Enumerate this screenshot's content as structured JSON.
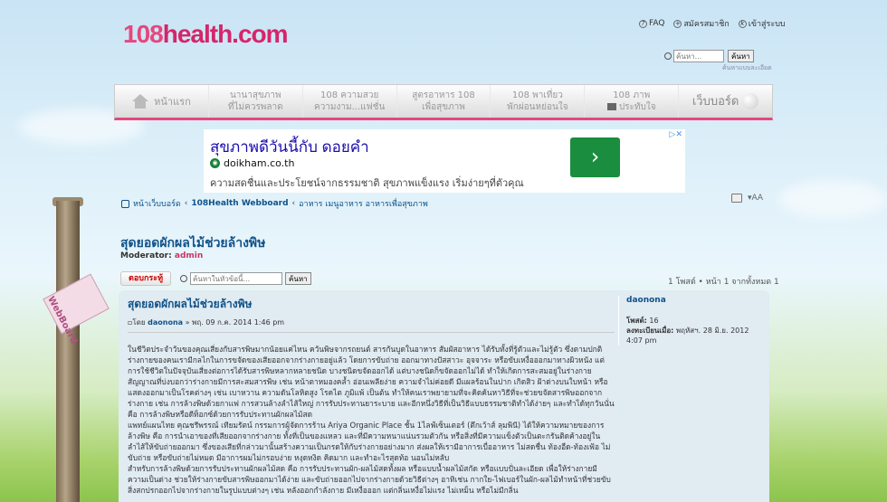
{
  "brand": {
    "logo_num": "108",
    "logo_text": "health.com"
  },
  "top_links": {
    "faq": "FAQ",
    "register": "สมัครสมาชิก",
    "login": "เข้าสู่ระบบ"
  },
  "site_search": {
    "placeholder": "ค้นหา...",
    "button": "ค้นหา",
    "advanced": "ค้นหาแบบละเอียด"
  },
  "nav": {
    "home": "หน้าแรก",
    "items": [
      {
        "line1": "นานาสุขภาพ",
        "line2": "ที่ไม่ควรพลาด"
      },
      {
        "line1": "108 ความสวย",
        "line2": "ความงาม...แฟชั่น"
      },
      {
        "line1": "สูตรอาหาร 108",
        "line2": "เพื่อสุขภาพ"
      },
      {
        "line1": "108 พาเที่ยว",
        "line2": "พักผ่อนหย่อนใจ"
      },
      {
        "line1": "108 ภาพ",
        "line2": "ประทับใจ"
      }
    ],
    "webboard": "เว็บบอร์ด"
  },
  "ad": {
    "headline": "สุขภาพดีวันนี้กับ ดอยคำ",
    "domain": "doikham.co.th",
    "description": "ความสดชื่นและประโยชน์จากธรรมชาติ สุขภาพแข็งแรง เริ่มง่ายๆที่ตัวคุณ",
    "arrow": "›"
  },
  "breadcrumb": {
    "index": "หน้าเว็บบอร์ด",
    "forum": "108Health Webboard",
    "sub": "อาหาร เมนูอาหาร อาหารเพื่อสุขภาพ"
  },
  "topic": {
    "title": "สุดยอดผักผลไม้ช่วยล้างพิษ",
    "moderator_label": "Moderator:",
    "moderator": "admin"
  },
  "actions": {
    "reply": "ตอบกระทู้",
    "search_placeholder": "ค้นหาในหัวข้อนี้...",
    "search_button": "ค้นหา"
  },
  "pagination": "1 โพสต์ • หน้า 1 จากทั้งหมด 1",
  "post": {
    "title": "สุดยอดผักผลไม้ช่วยล้างพิษ",
    "by": "โดย",
    "author": "daonona",
    "date": "» พฤ. 09 ก.ค. 2014 1:46 pm",
    "paragraphs": [
      "ในชีวิตประจำวันของคุณเสี่ยงกับสารพิษมากน้อยแค่ไหน ควันพิษจากรถยนต์ สารกันบูดในอาหาร สัมผัสอาหาร ได้รับทั้งที่รู้ตัวและไม่รู้ตัว ซึ่งตามปกติร่างกายของคนเรามีกลไกในการขจัดของเสียออกจากร่างกายอยู่แล้ว โดยการขับถ่าย ออกมาทางปัสสาวะ อุจจาระ หรือขับเหงื่อออกมาทางผิวหนัง แต่การใช้ชีวิตในปัจจุบันเสี่ยงต่อการได้รับสารพิษหลากหลายชนิด บางชนิดขจัดออกได้ แต่บางชนิดก็ขจัดออกไม่ได้ ทำให้เกิดการสะสมอยู่ในร่างกาย สัญญาณที่บ่งบอกว่าร่างกายมีการสะสมสารพิษ เช่น หน้าตาหมองคล้ำ อ่อนเพลียง่าย ความจำไม่ค่อยดี มีแผลร้อนในปาก เกิดสิว ฝ้าด่างบนใบหน้า หรือแสดงออกมาเป็นโรคต่างๆ เช่น เบาหวาน ความดันโลหิตสูง โรคไต ภูมิแพ้ เป็นต้น ทำให้คนเราพยายามที่จะคิดค้นหาวิธีที่จะช่วยขจัดสารพิษออกจากร่างกาย เช่น การล้างพิษด้วยกาแฟ การสวนล้างลำไส้ใหญ่ การรับประทานยาระบาย และอีกหนึ่งวิธีที่เป็นวิธีแบบธรรมชาติทำได้ง่ายๆ และทำได้ทุกวันนั่นคือ การล้างพิษหรือดีท็อกซ์ด้วยการรับประทานผักผลไม้สด",
      "แพทย์แผนไทย คุณชรีพรรณ์ เทียมรัตน์ กรรมการผู้จัดการร้าน Ariya Organic Place ชั้น 1ไลฟ์เซ็นเตอร์ (ตึกเว้าส์ ลุมพินี) ได้ให้ความหมายของการล้างพิษ คือ การนำเอาของที่เสียออกจากร่างกาย ทั้งที่เป็นของแหลว และที่มีความหนาแน่นรวมตัวกัน หรือสิ่งที่มีความแข็งตัวเป็นตะกรันติดค้างอยู่ในลำไส้ให้ขับถ่ายออกมา ซึ่งของเสียที่กล่าวมานั้นสร้างความเป็นกรดให้กับร่างกายอย่างมาก ส่งผลให้เรามีอาการเบื่ออาหาร ไม่สดชื่น ท้องอืด-ท้องเฟ้อ ไม่ขับถ่าย หรือขับถ่ายไม่หมด มีอาการผมไม่กรอบง่าย หงุดหงิด คิดมาก และทำอะไรสุดท้อ นอนไม่หลับ",
      "สำหรับการล้างพิษด้วยการรับประทานผักผลไม้สด คือ การรับประทานผัก-ผลไม้สดทั้งผล หรือแบบน้ำผลไม้สกัด หรือแบบปั่นละเอียด เพื่อให้ร่างกายมีความเป็นด่าง ช่วยให้ร่างกายขับสารพิษออกมาได้ง่าย และขับถ่ายออกไปจากร่างกายด้วยวิธีต่างๆ อาทิเช่น กากใย-ไฟเบอร์ในผัก-ผลไม้ทำหน้าที่ช่วยขับสิ่งสกปรกออกไปจากร่างกายในรูปแบบต่างๆ เช่น หลังออกกำลังกาย มีเหงื่อออก แต่กลิ่นเหงื่อไม่แรง ไม่เหม็น หรือไม่มีกลิ่น"
    ]
  },
  "profile": {
    "username": "daonona",
    "posts_label": "โพสต์:",
    "posts": "16",
    "joined_label": "ลงทะเบียนเมื่อ:",
    "joined": "พฤหัสฯ. 28 มิ.ย. 2012 4:07 pm"
  },
  "signpost_text": "WebBoard",
  "colors": {
    "link": "#105289",
    "brand_pink": "#e6477d",
    "post_bg": "#e1ebf2",
    "ad_green": "#1a8d3e"
  }
}
